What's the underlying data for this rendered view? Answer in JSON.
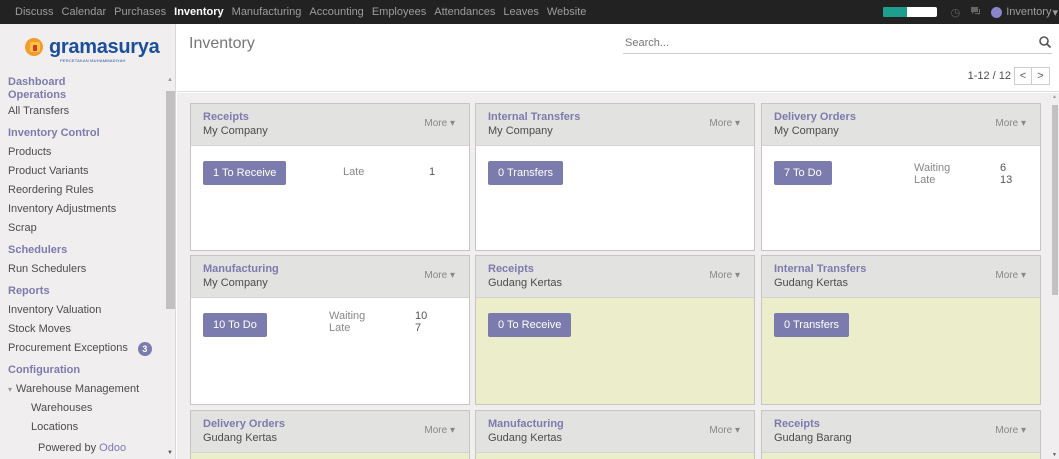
{
  "topbar": {
    "menu": [
      "Discuss",
      "Calendar",
      "Purchases",
      "Inventory",
      "Manufacturing",
      "Accounting",
      "Employees",
      "Attendances",
      "Leaves",
      "Website"
    ],
    "active": "Inventory",
    "progress_fraction": 0.45,
    "user": "Inventory",
    "colors": {
      "bar": "#222222",
      "progress": "#1f9e8e"
    }
  },
  "sidebar": {
    "logo_text": "gramasurya",
    "logo_subtext": "PERCETAKAN MUHAMMADIYAH",
    "dashboard": "Dashboard",
    "operations": "Operations",
    "all_transfers": "All Transfers",
    "inventory_control": "Inventory Control",
    "products": "Products",
    "product_variants": "Product Variants",
    "reordering_rules": "Reordering Rules",
    "inventory_adjustments": "Inventory Adjustments",
    "scrap": "Scrap",
    "schedulers": "Schedulers",
    "run_schedulers": "Run Schedulers",
    "reports": "Reports",
    "inventory_valuation": "Inventory Valuation",
    "stock_moves": "Stock Moves",
    "procurement_exceptions": "Procurement Exceptions",
    "procurement_exceptions_count": "3",
    "configuration": "Configuration",
    "warehouse_management": "Warehouse Management",
    "warehouses": "Warehouses",
    "locations": "Locations",
    "powered_by": "Powered by",
    "powered_brand": "Odoo"
  },
  "control_panel": {
    "title": "Inventory",
    "search_placeholder": "Search...",
    "pager": "1-12 / 12",
    "prev_icon": "chevron-left",
    "next_icon": "chevron-right"
  },
  "cards": [
    {
      "title": "Receipts",
      "subtitle": "My Company",
      "more": "More ▾",
      "button": "1 To Receive",
      "stats": [
        {
          "label": "Late",
          "value": "1"
        }
      ]
    },
    {
      "title": "Internal Transfers",
      "subtitle": "My Company",
      "more": "More ▾",
      "button": "0 Transfers",
      "stats": []
    },
    {
      "title": "Delivery Orders",
      "subtitle": "My Company",
      "more": "More ▾",
      "button": "7 To Do",
      "stats": [
        {
          "label": "Waiting",
          "value": "6"
        },
        {
          "label": "Late",
          "value": "13"
        }
      ]
    },
    {
      "title": "Manufacturing",
      "subtitle": "My Company",
      "more": "More ▾",
      "button": "10 To Do",
      "stats": [
        {
          "label": "Waiting",
          "value": "10"
        },
        {
          "label": "Late",
          "value": "7"
        }
      ]
    },
    {
      "title": "Receipts",
      "subtitle": "Gudang Kertas",
      "more": "More ▾",
      "button": "0 To Receive",
      "stats": []
    },
    {
      "title": "Internal Transfers",
      "subtitle": "Gudang Kertas",
      "more": "More ▾",
      "button": "0 Transfers",
      "stats": []
    },
    {
      "title": "Delivery Orders",
      "subtitle": "Gudang Kertas",
      "more": "More ▾",
      "button": "",
      "stats": []
    },
    {
      "title": "Manufacturing",
      "subtitle": "Gudang Kertas",
      "more": "More ▾",
      "button": "",
      "stats": []
    },
    {
      "title": "Receipts",
      "subtitle": "Gudang Barang",
      "more": "More ▾",
      "button": "",
      "stats": []
    }
  ],
  "colors": {
    "accent": "#7c7bad",
    "card_yellow": "#eceecb",
    "sidebar_bg": "#f0eeee"
  }
}
